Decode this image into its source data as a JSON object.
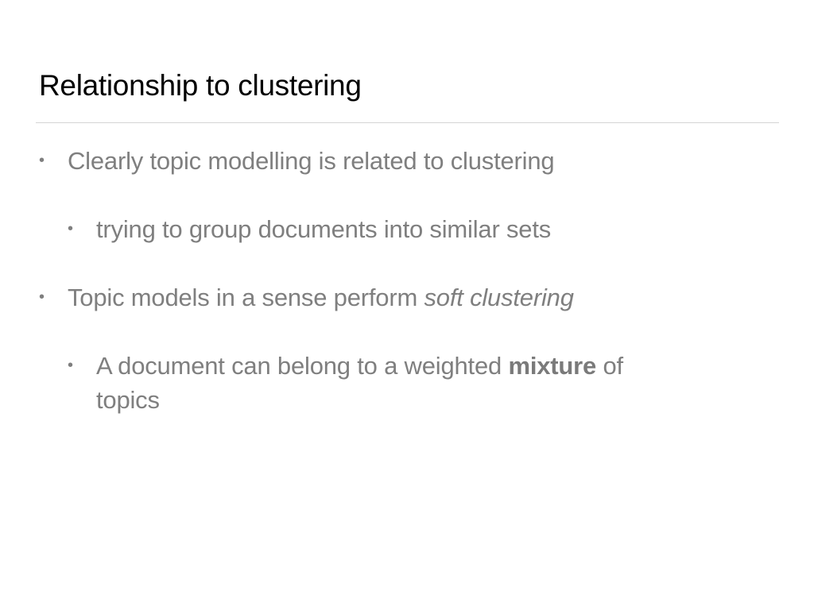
{
  "slide": {
    "title": "Relationship to clustering",
    "bullets": [
      {
        "level": 1,
        "text": "Clearly topic modelling is related to clustering"
      },
      {
        "level": 2,
        "text": "trying to group documents into similar sets"
      },
      {
        "level": 1,
        "text_before": "Topic models in a sense perform ",
        "text_italic": "soft clustering"
      },
      {
        "level": 2,
        "text_before": "A document can belong to a weighted ",
        "text_bold": "mixture",
        "text_after": " of",
        "text_line2": "topics"
      }
    ],
    "bullet_glyph": "•"
  }
}
